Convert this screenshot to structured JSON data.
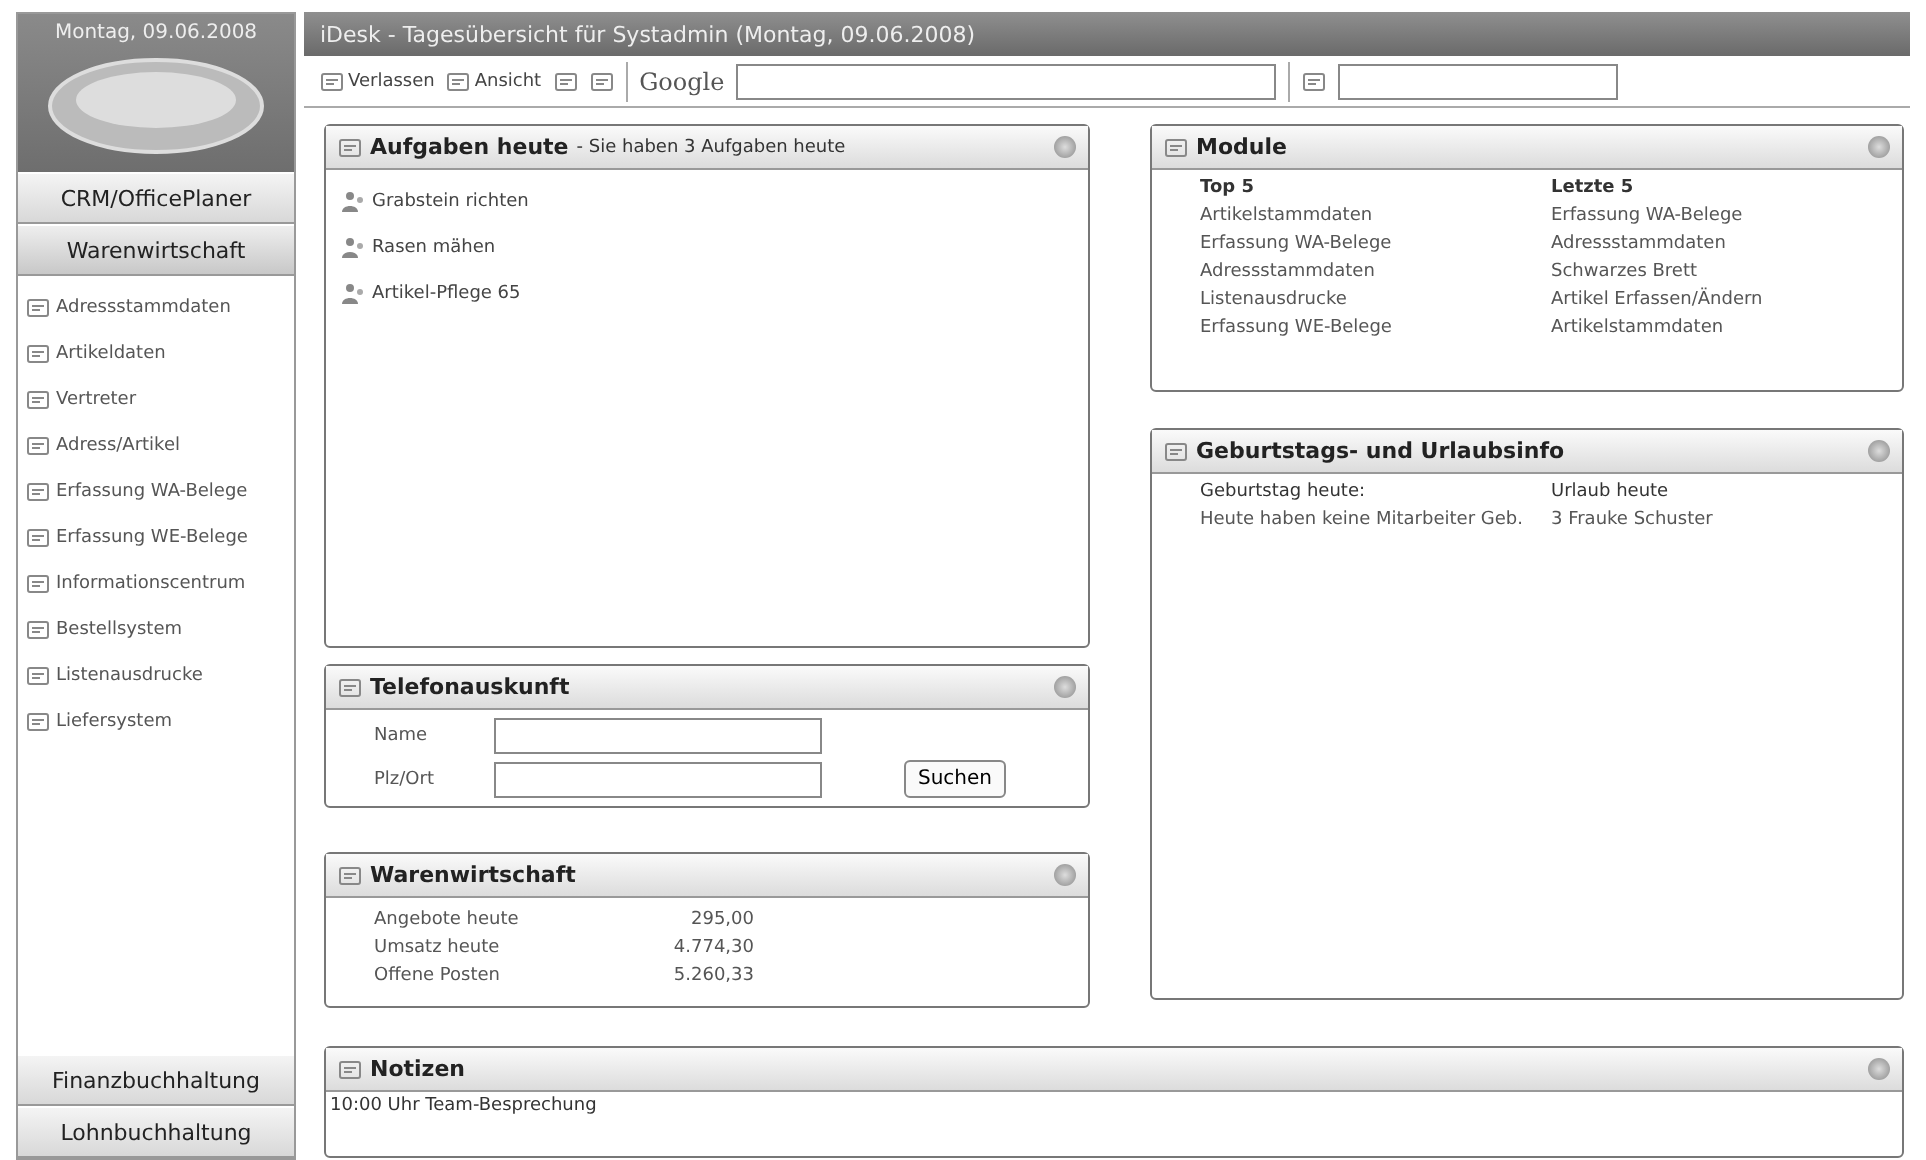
{
  "sidebar": {
    "date": "Montag, 09.06.2008",
    "sections": [
      {
        "label": "CRM/OfficePlaner",
        "expanded": false
      },
      {
        "label": "Warenwirtschaft",
        "expanded": true
      }
    ],
    "items": [
      "Adressstammdaten",
      "Artikeldaten",
      "Vertreter",
      "Adress/Artikel",
      "Erfassung WA-Belege",
      "Erfassung WE-Belege",
      "Informationscentrum",
      "Bestellsystem",
      "Listenausdrucke",
      "Liefersystem"
    ],
    "bottom_sections": [
      "Finanzbuchhaltung",
      "Lohnbuchhaltung"
    ]
  },
  "window": {
    "title": "iDesk - Tagesübersicht für Systadmin (Montag, 09.06.2008)"
  },
  "toolbar": {
    "buttons": [
      "Verlassen",
      "Ansicht"
    ],
    "search_label": "Google"
  },
  "tasks": {
    "title": "Aufgaben heute",
    "subtitle": "- Sie haben 3 Aufgaben heute",
    "items": [
      "Grabstein richten",
      "Rasen mähen",
      "Artikel-Pflege 65"
    ]
  },
  "phone": {
    "title": "Telefonauskunft",
    "fields": [
      "Name",
      "Plz/Ort"
    ],
    "button": "Suchen"
  },
  "stock": {
    "title": "Warenwirtschaft",
    "rows": [
      {
        "label": "Angebote heute",
        "value": "295,00"
      },
      {
        "label": "Umsatz heute",
        "value": "4.774,30"
      },
      {
        "label": "Offene Posten",
        "value": "5.260,33"
      }
    ]
  },
  "modules": {
    "title": "Module",
    "columns": [
      {
        "heading": "Top 5",
        "items": [
          "Artikelstammdaten",
          "Erfassung WA-Belege",
          "Adressstammdaten",
          "Listenausdrucke",
          "Erfassung WE-Belege"
        ]
      },
      {
        "heading": "Letzte 5",
        "items": [
          "Erfassung WA-Belege",
          "Adressstammdaten",
          "Schwarzes Brett",
          "Artikel Erfassen/Ändern",
          "Artikelstammdaten"
        ]
      }
    ]
  },
  "birthdays": {
    "title": "Geburtstags- und Urlaubsinfo",
    "columns": [
      {
        "heading": "Geburtstag heute:",
        "items": [
          "Heute haben keine Mitarbeiter Geb."
        ]
      },
      {
        "heading": "Urlaub heute",
        "items": [
          "3 Frauke Schuster"
        ]
      }
    ]
  },
  "notes": {
    "title": "Notizen",
    "text": "10:00 Uhr Team-Besprechung"
  }
}
